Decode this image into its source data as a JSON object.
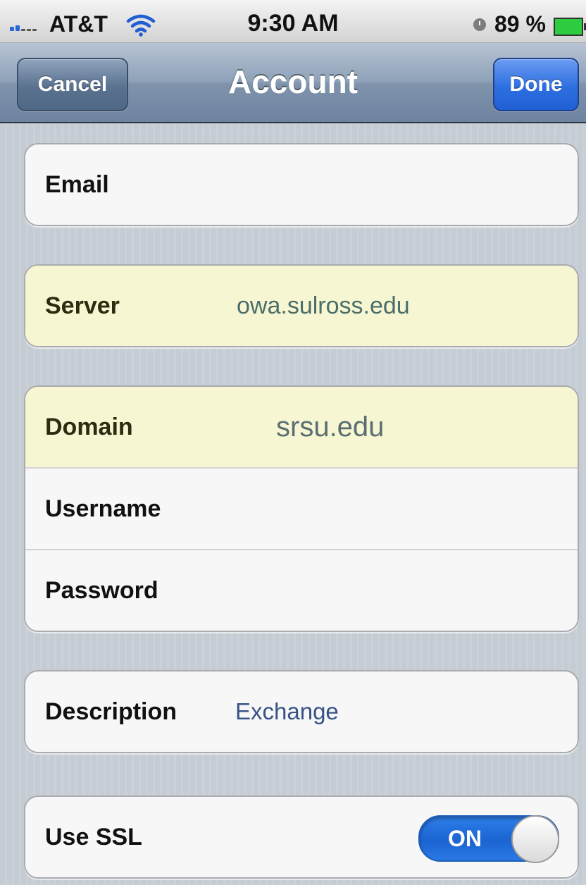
{
  "status_bar": {
    "carrier": "AT&T",
    "time": "9:30 AM",
    "battery_percent": "89 %",
    "icons": [
      "signal-icon",
      "wifi-icon",
      "alarm-icon",
      "battery-icon"
    ],
    "battery_level": 0.89
  },
  "nav": {
    "title": "Account",
    "cancel_label": "Cancel",
    "done_label": "Done"
  },
  "form": {
    "email": {
      "label": "Email",
      "value": ""
    },
    "server": {
      "label": "Server",
      "value": "owa.sulross.edu"
    },
    "domain": {
      "label": "Domain",
      "value": "srsu.edu"
    },
    "username": {
      "label": "Username",
      "value": ""
    },
    "password": {
      "label": "Password",
      "value": ""
    },
    "description": {
      "label": "Description",
      "value": "Exchange"
    },
    "use_ssl": {
      "label": "Use SSL",
      "state": "ON"
    }
  },
  "colors": {
    "nav_bar": "#7f93ab",
    "done_button": "#2e6fe0",
    "highlight_row": "#f6f6d2",
    "toggle_on": "#1b64d2",
    "value_text": "#385487"
  }
}
